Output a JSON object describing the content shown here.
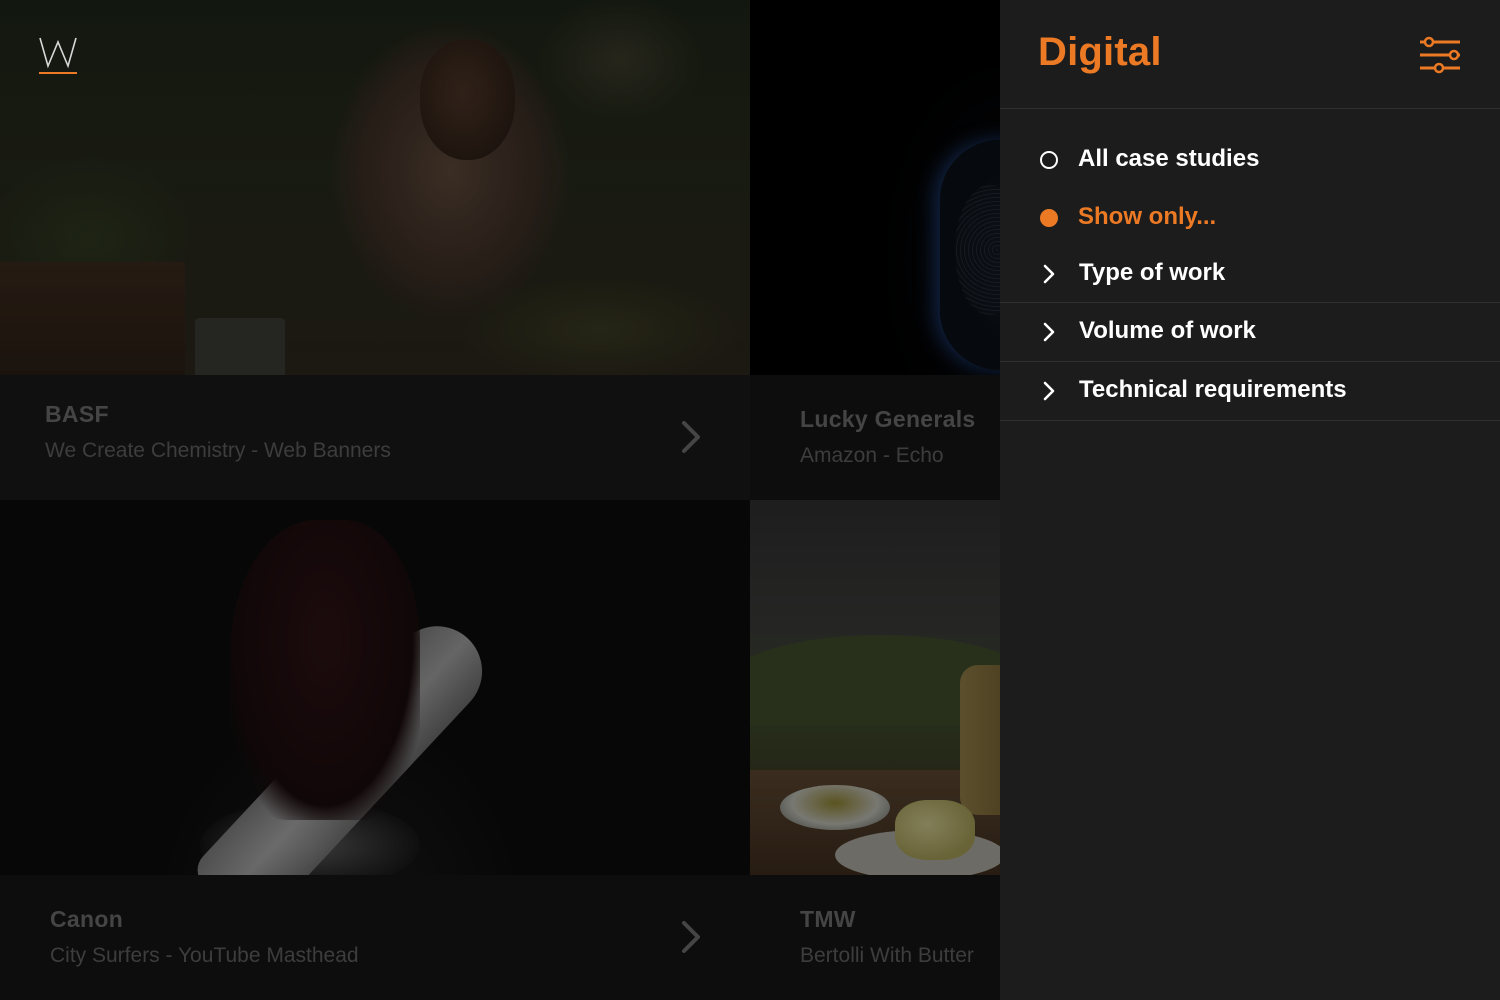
{
  "logo": {
    "letter": "W"
  },
  "tiles": [
    {
      "client": "BASF",
      "project": "We Create Chemistry - Web Banners"
    },
    {
      "client": "Lucky Generals",
      "project": "Amazon - Echo"
    },
    {
      "client": "Canon",
      "project": "City Surfers - YouTube Masthead"
    },
    {
      "client": "TMW",
      "project": "Bertolli With Butter"
    }
  ],
  "panel": {
    "title": "Digital",
    "options": [
      {
        "label": "All case studies",
        "selected": false
      },
      {
        "label": "Show only...",
        "selected": true
      }
    ],
    "sections": [
      {
        "label": "Type of work"
      },
      {
        "label": "Volume of work"
      },
      {
        "label": "Technical requirements"
      }
    ]
  },
  "colors": {
    "accent": "#ec7a25",
    "panel_bg": "#1c1c1c",
    "caption_bg": "#191919",
    "white": "#ffffff"
  },
  "icons": {
    "logo": "w-logo-icon",
    "filter": "sliders-icon",
    "tile_arrow": "chevron-right-icon",
    "section_arrow": "chevron-right-icon",
    "radio_off": "radio-empty-icon",
    "radio_on": "radio-filled-icon"
  }
}
